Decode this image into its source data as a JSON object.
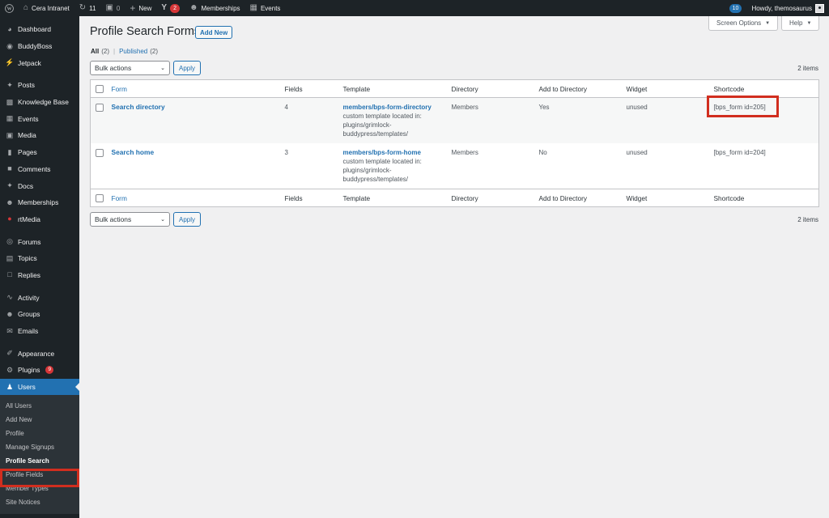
{
  "adminbar": {
    "site_name": "Cera Intranet",
    "updates_count": "11",
    "comments_count": "0",
    "new_label": "New",
    "yoast_badge": "2",
    "memberships_label": "Memberships",
    "events_label": "Events",
    "notifications_badge": "10",
    "howdy": "Howdy, themosaurus"
  },
  "sidebar": {
    "items": [
      {
        "label": "Dashboard",
        "icon": "dashboard-icon"
      },
      {
        "label": "BuddyBoss",
        "icon": "buddyboss-icon"
      },
      {
        "label": "Jetpack",
        "icon": "jetpack-icon"
      },
      {
        "label": "Posts",
        "icon": "pin-icon"
      },
      {
        "label": "Knowledge Base",
        "icon": "book-icon"
      },
      {
        "label": "Events",
        "icon": "calendar-icon"
      },
      {
        "label": "Media",
        "icon": "media-icon"
      },
      {
        "label": "Pages",
        "icon": "page-icon"
      },
      {
        "label": "Comments",
        "icon": "comment-icon"
      },
      {
        "label": "Docs",
        "icon": "pin-icon"
      },
      {
        "label": "Memberships",
        "icon": "groups-icon"
      },
      {
        "label": "rtMedia",
        "icon": "rtmedia-icon"
      },
      {
        "label": "Forums",
        "icon": "forums-icon"
      },
      {
        "label": "Topics",
        "icon": "topics-icon"
      },
      {
        "label": "Replies",
        "icon": "replies-icon"
      },
      {
        "label": "Activity",
        "icon": "activity-icon"
      },
      {
        "label": "Groups",
        "icon": "groups-icon"
      },
      {
        "label": "Emails",
        "icon": "email-icon"
      },
      {
        "label": "Appearance",
        "icon": "brush-icon"
      },
      {
        "label": "Plugins",
        "icon": "plugin-icon",
        "badge": "9"
      },
      {
        "label": "Users",
        "icon": "user-icon"
      }
    ],
    "submenu": [
      "All Users",
      "Add New",
      "Profile",
      "Manage Signups",
      "Profile Search",
      "Profile Fields",
      "Member Types",
      "Site Notices"
    ]
  },
  "header": {
    "screen_options": "Screen Options",
    "help": "Help",
    "title": "Profile Search Forms",
    "add_new": "Add New"
  },
  "filters": {
    "all_label": "All",
    "all_count": "(2)",
    "separator": "|",
    "published_label": "Published",
    "published_count": "(2)"
  },
  "tablenav": {
    "bulk_actions": "Bulk actions",
    "apply": "Apply",
    "items_count": "2 items"
  },
  "table": {
    "columns": [
      "Form",
      "Fields",
      "Template",
      "Directory",
      "Add to Directory",
      "Widget",
      "Shortcode"
    ],
    "rows": [
      {
        "form": "Search directory",
        "fields": "4",
        "template_link": "members/bps-form-directory",
        "template_line1": "custom template located in:",
        "template_line2": "plugins/grimlock-",
        "template_line3": "buddypress/templates/",
        "directory": "Members",
        "add_to_directory": "Yes",
        "widget": "unused",
        "shortcode": "[bps_form id=205]"
      },
      {
        "form": "Search home",
        "fields": "3",
        "template_link": "members/bps-form-home",
        "template_line1": "custom template located in:",
        "template_line2": "plugins/grimlock-",
        "template_line3": "buddypress/templates/",
        "directory": "Members",
        "add_to_directory": "No",
        "widget": "unused",
        "shortcode": "[bps_form id=204]"
      }
    ]
  },
  "colors": {
    "admin_dark": "#1d2327",
    "accent_blue": "#2271b1",
    "highlight_red": "#d12e1f"
  }
}
